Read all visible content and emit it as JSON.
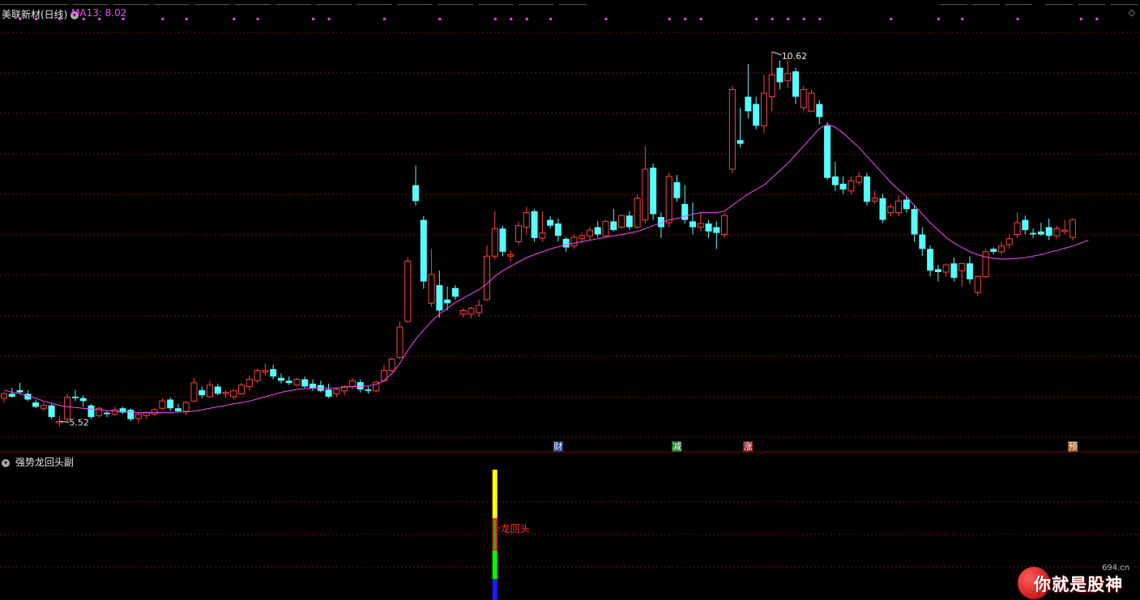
{
  "stock": {
    "name": "美联新材(日线)",
    "ma_legend": "MA13: 8.02"
  },
  "indicator": {
    "name": "强势龙回头副",
    "signal_label": "龙回头"
  },
  "labels": {
    "high": "10.62",
    "low": "5.52"
  },
  "events": [
    {
      "label": "财",
      "bar": 70,
      "color": "#2a3a8a"
    },
    {
      "label": "减",
      "bar": 85,
      "color": "#1c7a2a"
    },
    {
      "label": "涨",
      "bar": 94,
      "color": "#8a1a1a"
    },
    {
      "label": "预",
      "bar": 135,
      "color": "#a05a10"
    }
  ],
  "colors": {
    "up": "#ff4040",
    "down": "#54ffff",
    "ma": "#ff44ff",
    "grid": "#7a1010"
  },
  "icons": {
    "collapse": "diamond-icon",
    "panel": "chevron-icon"
  },
  "watermark": {
    "text": "你就是股神",
    "site": "694.cn"
  },
  "chart_data": {
    "type": "candlestick",
    "ylim": [
      5.3,
      11.0
    ],
    "ma_period": 13,
    "ma_last": 8.02,
    "high_mark": 10.62,
    "low_mark": 5.52,
    "bars": [
      [
        5.84,
        5.92,
        5.78,
        5.9
      ],
      [
        5.9,
        5.98,
        5.85,
        5.86
      ],
      [
        5.95,
        6.05,
        5.9,
        5.92
      ],
      [
        5.9,
        5.95,
        5.8,
        5.82
      ],
      [
        5.78,
        5.82,
        5.7,
        5.72
      ],
      [
        5.7,
        5.78,
        5.66,
        5.74
      ],
      [
        5.74,
        5.76,
        5.55,
        5.58
      ],
      [
        5.5,
        5.6,
        5.45,
        5.52
      ],
      [
        5.55,
        5.9,
        5.52,
        5.85
      ],
      [
        5.86,
        5.95,
        5.8,
        5.84
      ],
      [
        5.84,
        5.88,
        5.72,
        5.8
      ],
      [
        5.74,
        5.76,
        5.55,
        5.58
      ],
      [
        5.6,
        5.72,
        5.57,
        5.7
      ],
      [
        5.64,
        5.66,
        5.58,
        5.62
      ],
      [
        5.62,
        5.72,
        5.6,
        5.68
      ],
      [
        5.7,
        5.72,
        5.62,
        5.64
      ],
      [
        5.68,
        5.7,
        5.52,
        5.55
      ],
      [
        5.56,
        5.64,
        5.5,
        5.62
      ],
      [
        5.6,
        5.66,
        5.55,
        5.64
      ],
      [
        5.62,
        5.7,
        5.6,
        5.68
      ],
      [
        5.7,
        5.84,
        5.68,
        5.8
      ],
      [
        5.82,
        5.85,
        5.66,
        5.7
      ],
      [
        5.7,
        5.76,
        5.64,
        5.66
      ],
      [
        5.66,
        5.8,
        5.6,
        5.78
      ],
      [
        5.8,
        6.12,
        5.78,
        6.05
      ],
      [
        5.95,
        6.0,
        5.84,
        5.88
      ],
      [
        5.86,
        6.08,
        5.85,
        6.02
      ],
      [
        6.0,
        6.04,
        5.88,
        5.9
      ],
      [
        5.9,
        5.95,
        5.84,
        5.92
      ],
      [
        5.86,
        5.96,
        5.82,
        5.94
      ],
      [
        5.9,
        6.05,
        5.88,
        6.02
      ],
      [
        6.0,
        6.15,
        5.95,
        6.1
      ],
      [
        6.08,
        6.25,
        6.05,
        6.22
      ],
      [
        6.2,
        6.32,
        6.15,
        6.22
      ],
      [
        6.24,
        6.3,
        6.1,
        6.14
      ],
      [
        6.12,
        6.18,
        6.04,
        6.08
      ],
      [
        6.08,
        6.14,
        6.02,
        6.05
      ],
      [
        6.02,
        6.12,
        6.0,
        6.1
      ],
      [
        6.1,
        6.14,
        5.98,
        6.0
      ],
      [
        6.04,
        6.1,
        5.94,
        5.98
      ],
      [
        6.02,
        6.08,
        5.92,
        5.94
      ],
      [
        5.96,
        6.04,
        5.84,
        5.86
      ],
      [
        5.9,
        5.98,
        5.86,
        5.96
      ],
      [
        5.94,
        6.02,
        5.88,
        6.0
      ],
      [
        6.0,
        6.12,
        5.96,
        6.08
      ],
      [
        6.06,
        6.1,
        5.92,
        5.96
      ],
      [
        5.96,
        6.0,
        5.9,
        5.94
      ],
      [
        5.94,
        6.08,
        5.92,
        6.06
      ],
      [
        6.08,
        6.3,
        6.06,
        6.22
      ],
      [
        6.22,
        6.4,
        6.2,
        6.38
      ],
      [
        6.4,
        6.9,
        6.38,
        6.82
      ],
      [
        6.9,
        7.78,
        6.88,
        7.73
      ],
      [
        8.78,
        9.05,
        8.5,
        8.56
      ],
      [
        8.3,
        8.35,
        7.35,
        7.45
      ],
      [
        7.15,
        7.9,
        7.1,
        7.55
      ],
      [
        7.4,
        7.6,
        6.95,
        7.05
      ],
      [
        7.2,
        7.38,
        7.05,
        7.15
      ],
      [
        7.36,
        7.4,
        7.2,
        7.24
      ],
      [
        7.0,
        7.08,
        6.95,
        7.05
      ],
      [
        7.0,
        7.1,
        6.94,
        7.08
      ],
      [
        7.02,
        7.2,
        6.96,
        7.12
      ],
      [
        7.2,
        7.95,
        7.18,
        7.8
      ],
      [
        7.8,
        8.42,
        7.75,
        8.18
      ],
      [
        8.18,
        8.22,
        7.8,
        7.86
      ],
      [
        7.8,
        7.88,
        7.72,
        7.82
      ],
      [
        8.0,
        8.28,
        7.96,
        8.22
      ],
      [
        8.2,
        8.48,
        8.1,
        8.4
      ],
      [
        8.42,
        8.45,
        8.0,
        8.05
      ],
      [
        8.05,
        8.42,
        8.0,
        8.12
      ],
      [
        8.3,
        8.35,
        8.18,
        8.22
      ],
      [
        8.25,
        8.32,
        8.0,
        8.08
      ],
      [
        8.04,
        8.06,
        7.86,
        7.92
      ],
      [
        7.94,
        8.1,
        7.9,
        8.06
      ],
      [
        8.04,
        8.12,
        7.98,
        8.08
      ],
      [
        8.08,
        8.2,
        8.02,
        8.16
      ],
      [
        8.2,
        8.28,
        8.06,
        8.1
      ],
      [
        8.08,
        8.3,
        8.06,
        8.28
      ],
      [
        8.28,
        8.45,
        8.14,
        8.16
      ],
      [
        8.2,
        8.38,
        8.18,
        8.36
      ],
      [
        8.36,
        8.42,
        8.16,
        8.2
      ],
      [
        8.2,
        8.65,
        8.18,
        8.6
      ],
      [
        8.3,
        9.32,
        8.25,
        9.0
      ],
      [
        9.02,
        9.08,
        8.3,
        8.38
      ],
      [
        8.34,
        8.4,
        8.05,
        8.2
      ],
      [
        8.26,
        8.95,
        8.2,
        8.9
      ],
      [
        8.82,
        8.92,
        8.55,
        8.6
      ],
      [
        8.52,
        8.78,
        8.25,
        8.3
      ],
      [
        8.28,
        8.54,
        8.1,
        8.2
      ],
      [
        8.2,
        8.4,
        8.15,
        8.25
      ],
      [
        8.25,
        8.3,
        8.05,
        8.14
      ],
      [
        8.2,
        8.28,
        7.9,
        8.12
      ],
      [
        8.1,
        8.4,
        8.05,
        8.36
      ],
      [
        9.0,
        10.15,
        8.95,
        10.1
      ],
      [
        9.4,
        9.85,
        9.3,
        9.35
      ],
      [
        10.0,
        10.45,
        9.7,
        9.8
      ],
      [
        9.9,
        10.0,
        9.55,
        9.6
      ],
      [
        9.6,
        10.3,
        9.5,
        10.05
      ],
      [
        10.0,
        10.62,
        9.8,
        10.3
      ],
      [
        10.4,
        10.5,
        10.1,
        10.2
      ],
      [
        10.22,
        10.55,
        10.12,
        10.32
      ],
      [
        10.35,
        10.4,
        9.9,
        10.0
      ],
      [
        9.85,
        10.15,
        9.8,
        10.1
      ],
      [
        9.8,
        10.1,
        9.8,
        10.05
      ],
      [
        9.9,
        9.95,
        9.62,
        9.72
      ],
      [
        9.6,
        9.65,
        8.85,
        8.88
      ],
      [
        8.9,
        9.1,
        8.7,
        8.78
      ],
      [
        8.8,
        8.9,
        8.66,
        8.72
      ],
      [
        8.7,
        8.9,
        8.65,
        8.84
      ],
      [
        8.82,
        8.96,
        8.78,
        8.9
      ],
      [
        8.9,
        8.95,
        8.5,
        8.55
      ],
      [
        8.56,
        8.7,
        8.52,
        8.6
      ],
      [
        8.6,
        8.66,
        8.26,
        8.3
      ],
      [
        8.4,
        8.52,
        8.35,
        8.48
      ],
      [
        8.4,
        8.64,
        8.35,
        8.56
      ],
      [
        8.58,
        8.62,
        8.4,
        8.45
      ],
      [
        8.45,
        8.5,
        8.0,
        8.1
      ],
      [
        8.1,
        8.2,
        7.8,
        7.9
      ],
      [
        7.9,
        7.95,
        7.52,
        7.6
      ],
      [
        7.62,
        7.68,
        7.45,
        7.58
      ],
      [
        7.58,
        7.7,
        7.52,
        7.68
      ],
      [
        7.7,
        7.78,
        7.45,
        7.5
      ],
      [
        7.6,
        7.68,
        7.38,
        7.7
      ],
      [
        7.7,
        7.8,
        7.42,
        7.48
      ],
      [
        7.3,
        7.48,
        7.25,
        7.52
      ],
      [
        7.52,
        7.9,
        7.5,
        7.86
      ],
      [
        7.9,
        7.92,
        7.82,
        7.86
      ],
      [
        7.86,
        8.0,
        7.82,
        7.94
      ],
      [
        7.96,
        8.1,
        7.9,
        8.04
      ],
      [
        8.1,
        8.4,
        8.05,
        8.26
      ],
      [
        8.3,
        8.36,
        8.1,
        8.16
      ],
      [
        8.12,
        8.18,
        8.05,
        8.1
      ],
      [
        8.14,
        8.26,
        8.08,
        8.1
      ],
      [
        8.2,
        8.32,
        8.02,
        8.08
      ],
      [
        8.08,
        8.22,
        8.04,
        8.18
      ],
      [
        8.14,
        8.3,
        8.1,
        8.16
      ],
      [
        8.06,
        8.32,
        8.02,
        8.3
      ]
    ],
    "ma": [
      5.95,
      5.92,
      5.9,
      5.87,
      5.84,
      5.8,
      5.77,
      5.74,
      5.72,
      5.71,
      5.7,
      5.69,
      5.68,
      5.67,
      5.66,
      5.65,
      5.65,
      5.64,
      5.64,
      5.64,
      5.64,
      5.64,
      5.65,
      5.65,
      5.66,
      5.68,
      5.7,
      5.72,
      5.74,
      5.76,
      5.78,
      5.8,
      5.83,
      5.86,
      5.89,
      5.92,
      5.94,
      5.96,
      5.97,
      5.98,
      5.98,
      5.98,
      5.98,
      5.99,
      6.0,
      6.0,
      6.01,
      6.03,
      6.08,
      6.18,
      6.32,
      6.5,
      6.65,
      6.78,
      6.9,
      7.0,
      7.08,
      7.16,
      7.22,
      7.28,
      7.34,
      7.42,
      7.52,
      7.6,
      7.66,
      7.72,
      7.78,
      7.82,
      7.86,
      7.9,
      7.93,
      7.96,
      7.98,
      8.0,
      8.02,
      8.04,
      8.06,
      8.08,
      8.1,
      8.12,
      8.14,
      8.18,
      8.22,
      8.26,
      8.3,
      8.32,
      8.35,
      8.38,
      8.4,
      8.4,
      8.4,
      8.42,
      8.5,
      8.58,
      8.66,
      8.72,
      8.78,
      8.88,
      8.98,
      9.08,
      9.2,
      9.32,
      9.44,
      9.56,
      9.62,
      9.58,
      9.5,
      9.4,
      9.3,
      9.18,
      9.06,
      8.94,
      8.82,
      8.72,
      8.62,
      8.5,
      8.38,
      8.26,
      8.16,
      8.06,
      7.98,
      7.92,
      7.86,
      7.82,
      7.79,
      7.77,
      7.76,
      7.76,
      7.77,
      7.78,
      7.8,
      7.82,
      7.85,
      7.88,
      7.91,
      7.94,
      7.98,
      8.02
    ],
    "signal_bar": 62
  }
}
